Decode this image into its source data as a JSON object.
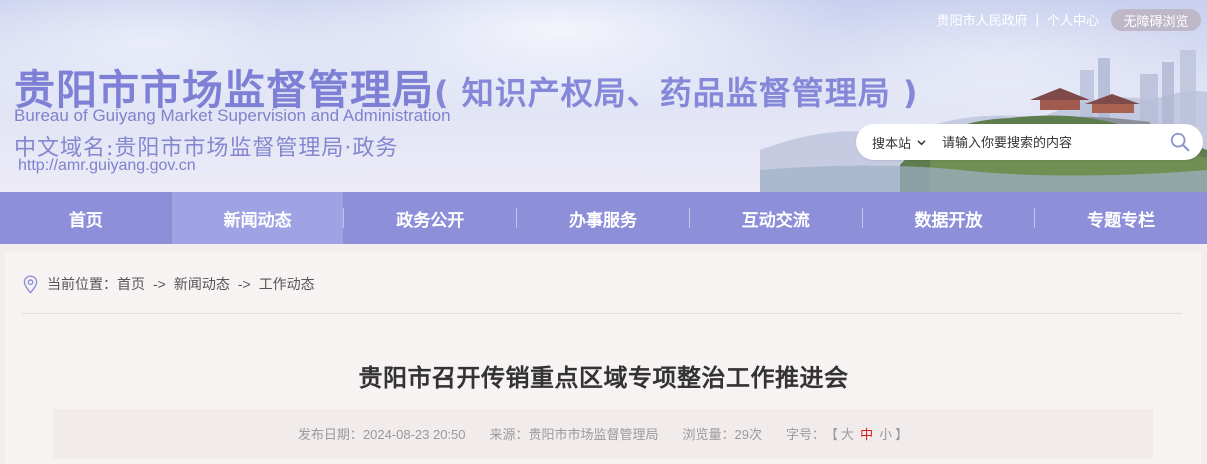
{
  "top_links": {
    "gov": "贵阳市人民政府",
    "separator": "|",
    "personal": "个人中心",
    "accessible": "无障碍浏览"
  },
  "site": {
    "title_main": "贵阳市市场监督管理局",
    "title_sub": "( 知识产权局、药品监督管理局 )",
    "title_en": "Bureau of Guiyang Market Supervision and Administration",
    "domain_label": "中文域名:贵阳市市场监督管理局·政务",
    "url": "http://amr.guiyang.gov.cn"
  },
  "search": {
    "scope": "搜本站",
    "placeholder": "请输入你要搜索的内容"
  },
  "nav": {
    "items": [
      "首页",
      "新闻动态",
      "政务公开",
      "办事服务",
      "互动交流",
      "数据开放",
      "专题专栏"
    ],
    "active": "新闻动态"
  },
  "breadcrumb": {
    "label": "当前位置：",
    "items": [
      "首页",
      "新闻动态",
      "工作动态"
    ],
    "arrow": "->"
  },
  "article": {
    "title": "贵阳市召开传销重点区域专项整治工作推进会",
    "publish": "发布日期：2024-08-23 20:50",
    "source": "来源：贵阳市市场监督管理局",
    "views": "浏览量：29次",
    "font_label": "字号：",
    "bracket_open": "【",
    "bracket_close": "】",
    "font_large": "大",
    "font_medium": "中",
    "font_small": "小"
  },
  "colors": {
    "nav_bg": "#8e8fd9",
    "nav_active": "#9fa3e4",
    "title_purple": "#7e80d6",
    "font_active": "#d81e1e"
  }
}
